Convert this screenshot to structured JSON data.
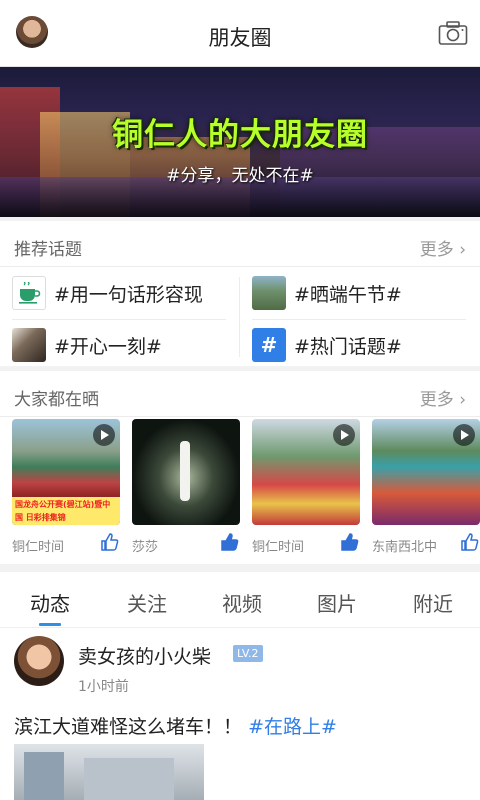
{
  "header": {
    "title": "朋友圈",
    "avatar_icon": "user-avatar",
    "camera_icon": "camera-icon"
  },
  "banner": {
    "headline": "铜仁人的大朋友圈",
    "subline": "#分享，无处不在#"
  },
  "topics": {
    "label": "推荐话题",
    "more": "更多",
    "items": [
      {
        "text": "#用一句话形容现",
        "icon": "tea-cup-icon"
      },
      {
        "text": "#晒端午节#",
        "icon": "park-photo"
      },
      {
        "text": "#开心一刻#",
        "icon": "people-photo"
      },
      {
        "text": "#热门话题#",
        "icon": "hash-icon"
      }
    ]
  },
  "gallery": {
    "label": "大家都在晒",
    "more": "更多",
    "cards": [
      {
        "author": "铜仁时间",
        "caption": "国龙舟公开赛(碧江站)暨中国\n日彩排集锦"
      },
      {
        "author": "莎莎"
      },
      {
        "author": "铜仁时间"
      },
      {
        "author": "东南西北中"
      }
    ]
  },
  "feed": {
    "tabs": [
      "动态",
      "关注",
      "视频",
      "图片",
      "附近"
    ],
    "active_tab": 0,
    "post": {
      "user": "卖女孩的小火柴",
      "level": "LV.2",
      "time": "1小时前",
      "text": "滨江大道难怪这么堵车！！",
      "tag": "#在路上#"
    }
  },
  "colors": {
    "accent": "#2f8fe6",
    "banner_headline": "#b7ff2a",
    "level_badge": "#8fb8e8"
  }
}
